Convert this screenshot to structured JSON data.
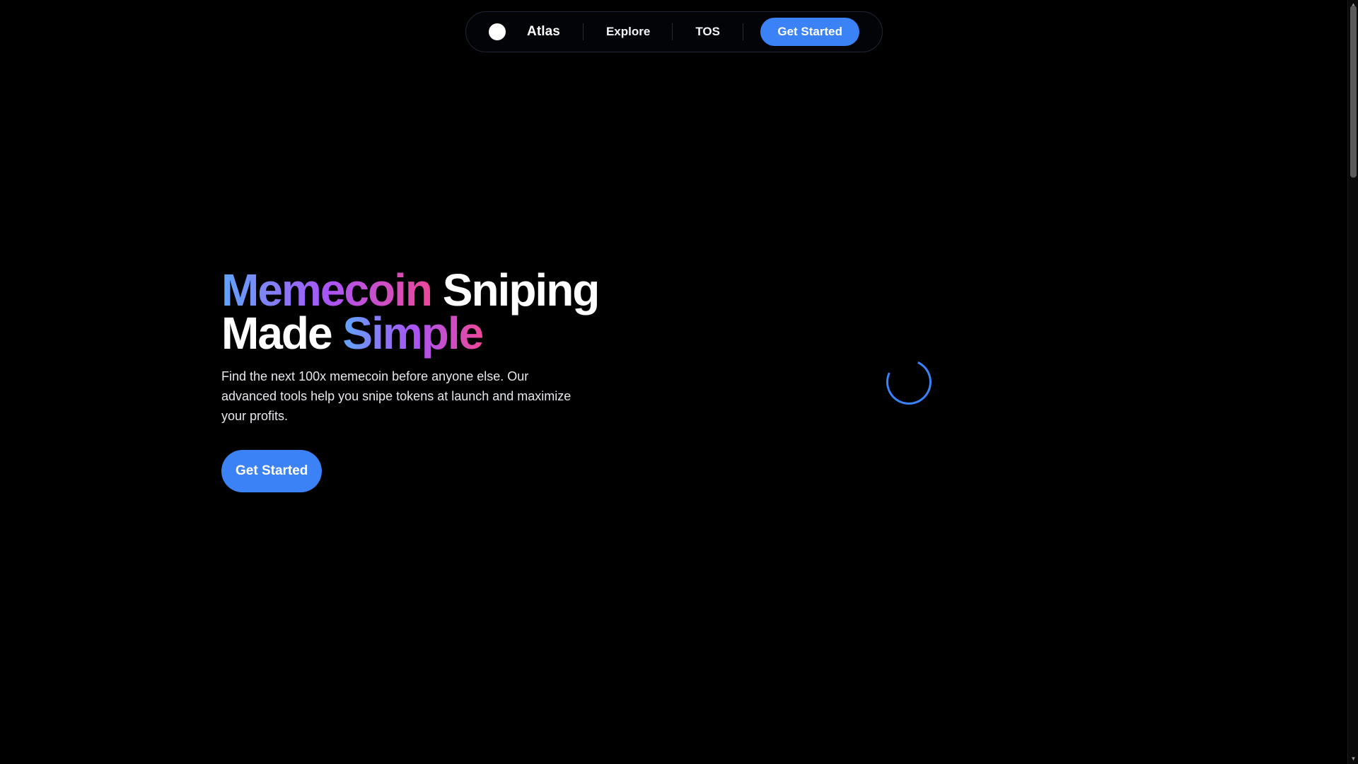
{
  "nav": {
    "brand": "Atlas",
    "links": [
      "Explore",
      "TOS"
    ],
    "cta_label": "Get Started"
  },
  "hero": {
    "headline": {
      "line1_gradient": "Memecoin",
      "line1_plain": "Sniping",
      "line2_plain": "Made",
      "line2_gradient": "Simple"
    },
    "subtext": "Find the next 100x memecoin before anyone else. Our advanced tools help you snipe tokens at launch and maximize your profits.",
    "cta_label": "Get Started"
  },
  "icons": {
    "logo": "white-circle-logo-icon",
    "spinner": "loading-spinner-icon",
    "scroll_up": "chevron-up-icon",
    "scroll_down": "chevron-down-icon"
  },
  "colors": {
    "background": "#000000",
    "accent": "#3b82f6",
    "gradient_start": "#60a5fa",
    "gradient_mid": "#a855f7",
    "gradient_end": "#ec4899"
  }
}
